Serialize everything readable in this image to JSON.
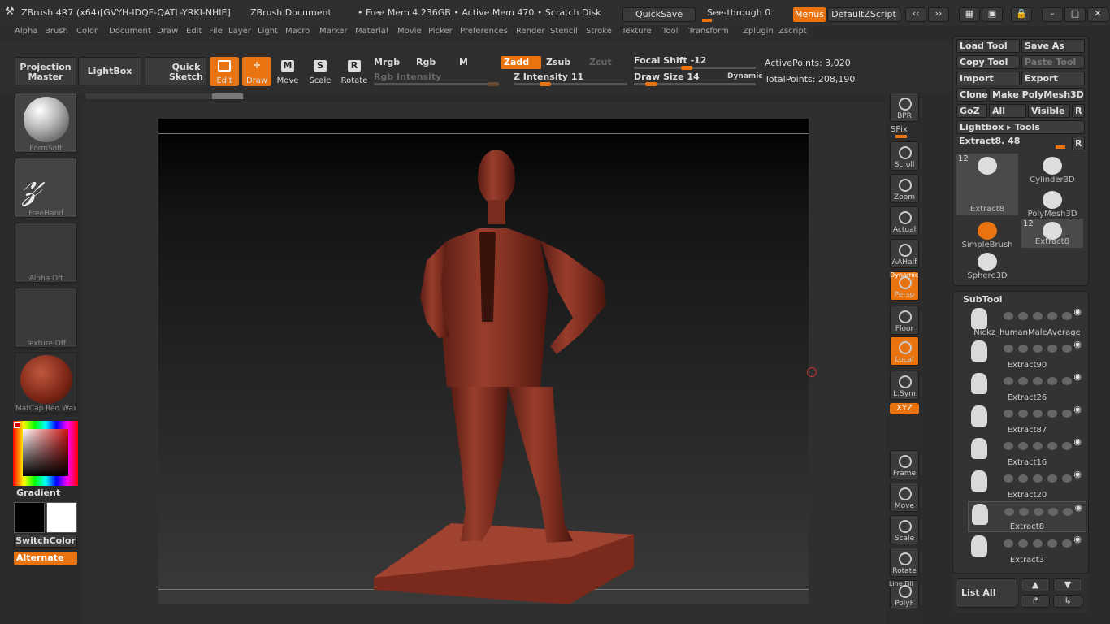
{
  "title": {
    "app": "ZBrush 4R7 (x64)[GVYH-IDQF-QATL-YRKI-NHIE]",
    "document": "ZBrush Document",
    "free_mem": "• Free Mem 4.236GB • Active Mem 470 • Scratch Disk",
    "quicksave": "QuickSave",
    "see_through": "See-through  0",
    "menus": "Menus",
    "default_zscript": "DefaultZScript"
  },
  "menu": [
    "Alpha",
    "Brush",
    "Color",
    "Document",
    "Draw",
    "Edit",
    "File",
    "Layer",
    "Light",
    "Macro",
    "Marker",
    "Material",
    "Movie",
    "Picker",
    "Preferences",
    "Render",
    "Stencil",
    "Stroke",
    "Texture",
    "Tool",
    "Transform",
    "Zplugin",
    "Zscript"
  ],
  "toolbar": {
    "projection_master": "Projection Master",
    "lightbox": "LightBox",
    "quick_sketch": "Quick Sketch",
    "edit": "Edit",
    "draw": "Draw",
    "move": "Move",
    "scale": "Scale",
    "rotate": "Rotate",
    "mrgb": "Mrgb",
    "rgb": "Rgb",
    "m": "M",
    "zadd": "Zadd",
    "zsub": "Zsub",
    "zcut": "Zcut",
    "rgb_intensity": "Rgb Intensity",
    "z_intensity": "Z Intensity 11",
    "focal_shift": "Focal Shift -12",
    "draw_size": "Draw Size 14",
    "dynamic": "Dynamic",
    "active_points": "ActivePoints: 3,020",
    "total_points": "TotalPoints: 208,190"
  },
  "left": {
    "brush": "FormSoft",
    "stroke": "FreeHand",
    "alpha": "Alpha Off",
    "texture": "Texture Off",
    "material": "MatCap Red Wax",
    "gradient": "Gradient",
    "switch_color": "SwitchColor",
    "alternate": "Alternate"
  },
  "right_tools": [
    "BPR",
    "SPix",
    "Scroll",
    "Zoom",
    "Actual",
    "AAHalf",
    "Persp",
    "Floor",
    "Local",
    "L.Sym",
    "Frame",
    "Move",
    "Scale",
    "Rotate",
    "PolyF"
  ],
  "right_tool_extra": {
    "dynamic": "Dynamic",
    "xyz": "XYZ",
    "line_fill": "Line Fill"
  },
  "tool_panel": {
    "load_tool": "Load Tool",
    "save_as": "Save As",
    "copy_tool": "Copy Tool",
    "paste_tool": "Paste Tool",
    "import": "Import",
    "export": "Export",
    "clone": "Clone",
    "make_polymesh": "Make PolyMesh3D",
    "goz": "GoZ",
    "all": "All",
    "visible": "Visible",
    "r": "R",
    "lightbox_tools": "Lightbox ▸ Tools",
    "current": "Extract8. 48",
    "thumbs": [
      {
        "name": "Extract8",
        "badge": "12"
      },
      {
        "name": "Cylinder3D",
        "badge": ""
      },
      {
        "name": "PolyMesh3D",
        "badge": ""
      },
      {
        "name": "SimpleBrush",
        "badge": ""
      },
      {
        "name": "Extract8",
        "badge": "12"
      },
      {
        "name": "Sphere3D",
        "badge": ""
      }
    ]
  },
  "subtool": {
    "header": "SubTool",
    "items": [
      "Nickz_humanMaleAverage",
      "Extract90",
      "Extract26",
      "Extract87",
      "Extract16",
      "Extract20",
      "Extract8",
      "Extract3"
    ],
    "list_all": "List All"
  }
}
